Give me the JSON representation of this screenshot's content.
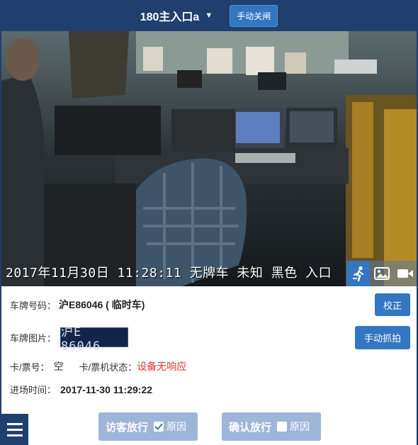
{
  "header": {
    "lane_name": "180主入口a",
    "caret_icon": "triangle-down-icon",
    "manual_close_label": "手动关闸"
  },
  "camera": {
    "overlay_text": "2017年11月30日 11:28:11 无牌车 未知 黑色 入口",
    "tools": [
      {
        "icon": "person-icon",
        "active": true
      },
      {
        "icon": "image-icon",
        "active": false
      },
      {
        "icon": "video-camera-icon",
        "active": false
      }
    ]
  },
  "info": {
    "plate_label": "车牌号码：",
    "plate_value": "沪E86046 ( 临时车)",
    "correct_button": "校正",
    "plate_image_label": "车牌图片：",
    "plate_image_text": "沪E 86046",
    "manual_capture_button": "手动抓拍",
    "card_label": "卡/票号：",
    "card_value": "空",
    "machine_status_label": "卡/票机状态：",
    "machine_status_value": "设备无响应",
    "entry_time_label": "进场时间：",
    "entry_time_value": "2017-11-30 11:29:22"
  },
  "actions": {
    "visitor_release_label": "访客放行",
    "visitor_reason_label": "原因",
    "visitor_reason_checked": true,
    "confirm_release_label": "确认放行",
    "confirm_reason_label": "原因",
    "confirm_reason_checked": false
  },
  "colors": {
    "header_bg": "#1f3f6e",
    "button_blue": "#3277c0",
    "action_disabled": "#9db6d8",
    "status_red": "#e0312d"
  }
}
